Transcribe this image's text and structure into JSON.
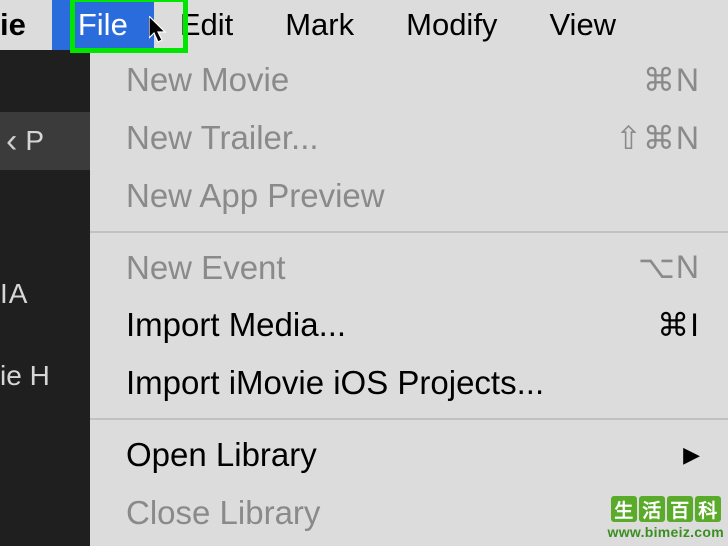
{
  "menubar": {
    "app_fragment": "ie",
    "items": [
      {
        "label": "File",
        "selected": true
      },
      {
        "label": "Edit",
        "selected": false
      },
      {
        "label": "Mark",
        "selected": false
      },
      {
        "label": "Modify",
        "selected": false
      },
      {
        "label": "View",
        "selected": false
      }
    ]
  },
  "sidebar": {
    "back_label": "P",
    "label_dia": "IA",
    "label_ieh": "ie H"
  },
  "dropdown": {
    "groups": [
      [
        {
          "label": "New Movie",
          "shortcut": "⌘N",
          "enabled": false
        },
        {
          "label": "New Trailer...",
          "shortcut": "⇧⌘N",
          "enabled": false
        },
        {
          "label": "New App Preview",
          "shortcut": "",
          "enabled": false
        }
      ],
      [
        {
          "label": "New Event",
          "shortcut": "⌥N",
          "enabled": false
        },
        {
          "label": "Import Media...",
          "shortcut": "⌘I",
          "enabled": true
        },
        {
          "label": "Import iMovie iOS Projects...",
          "shortcut": "",
          "enabled": true
        }
      ],
      [
        {
          "label": "Open Library",
          "shortcut": "",
          "enabled": true,
          "submenu": true
        },
        {
          "label": "Close Library",
          "shortcut": "",
          "enabled": false
        }
      ]
    ]
  },
  "watermark": {
    "chars": [
      "生",
      "活",
      "百",
      "科"
    ],
    "url": "www.bimeiz.com"
  }
}
